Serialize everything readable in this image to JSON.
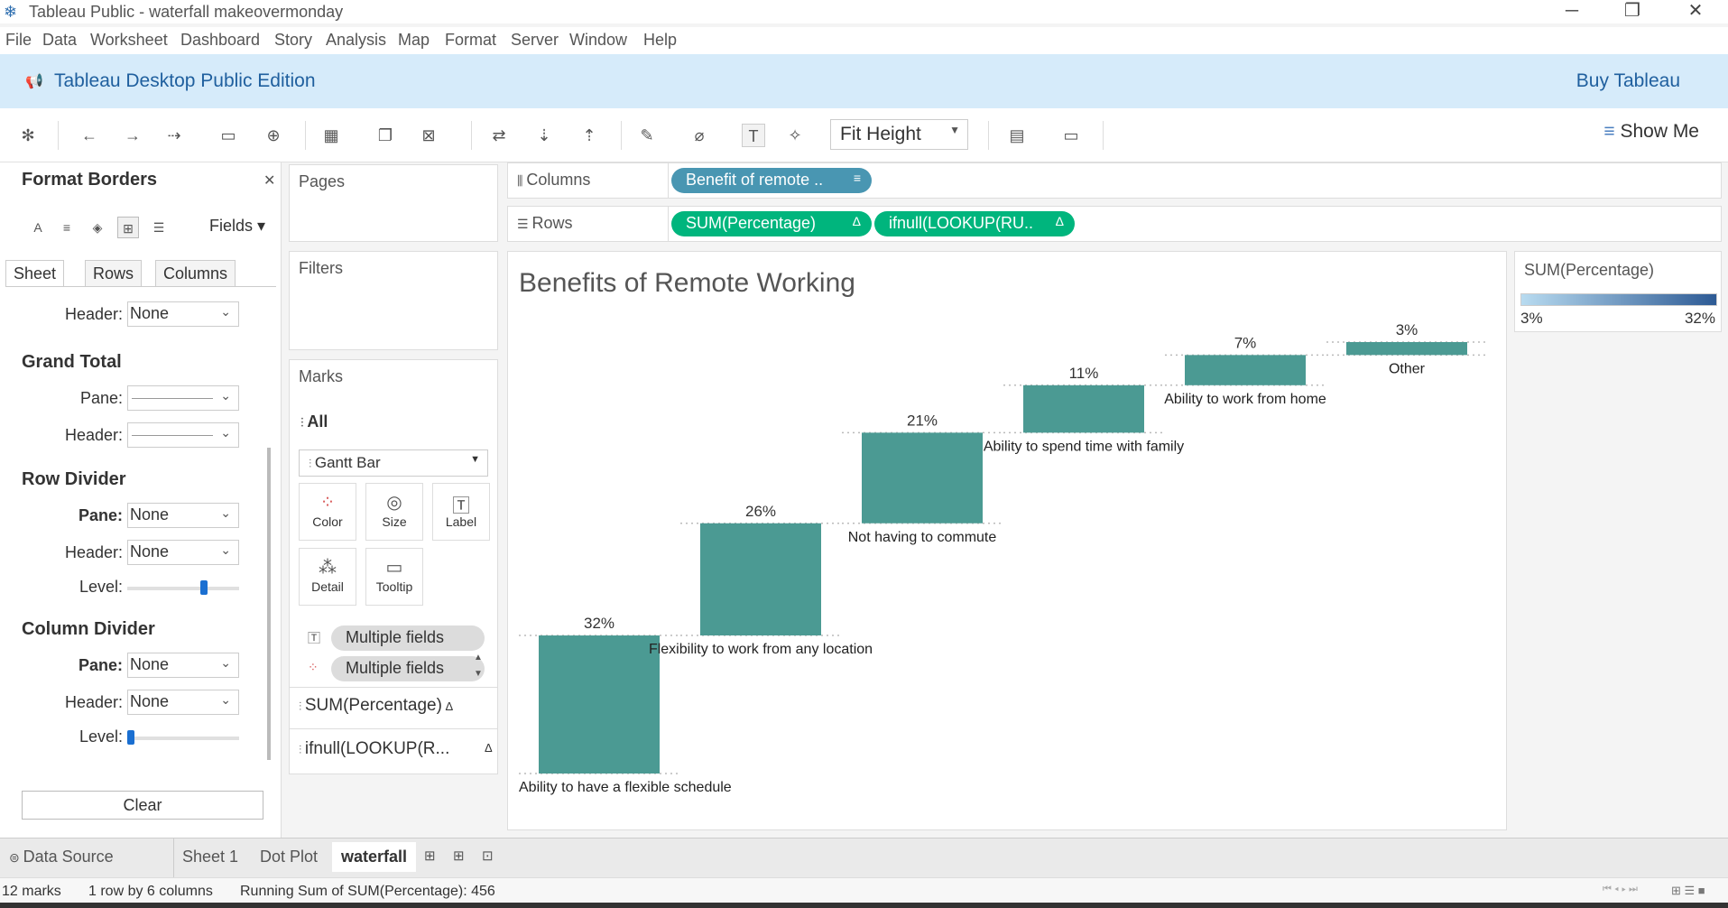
{
  "window": {
    "title": "Tableau Public - waterfall makeovermonday",
    "minimize": "─",
    "restore": "❐",
    "close": "✕"
  },
  "menu": [
    "File",
    "Data",
    "Worksheet",
    "Dashboard",
    "Story",
    "Analysis",
    "Map",
    "Format",
    "Server",
    "Window",
    "Help"
  ],
  "banner": {
    "edition": "Tableau Desktop Public Edition",
    "buy": "Buy Tableau"
  },
  "toolbar": {
    "fit": "Fit Height",
    "show_me": "Show Me"
  },
  "format_panel": {
    "title": "Format Borders",
    "fields_label": "Fields",
    "tabs": [
      "Sheet",
      "Rows",
      "Columns"
    ],
    "header_label": "Header:",
    "pane_label": "Pane:",
    "level_label": "Level:",
    "header_value": "None",
    "grand_total": {
      "title": "Grand Total"
    },
    "row_divider": {
      "title": "Row Divider",
      "pane": "None",
      "header": "None",
      "level": 0.7
    },
    "column_divider": {
      "title": "Column Divider",
      "pane": "None",
      "header": "None",
      "level": 0.0
    },
    "clear_label": "Clear"
  },
  "cards": {
    "pages": "Pages",
    "filters": "Filters",
    "marks": "Marks",
    "all": "All",
    "mark_type": "Gantt Bar",
    "buttons": [
      "Color",
      "Size",
      "Label",
      "Detail",
      "Tooltip"
    ],
    "mark_fields": [
      "Multiple fields",
      "Multiple fields"
    ],
    "measure_1": "SUM(Percentage)",
    "measure_2": "ifnull(LOOKUP(R..."
  },
  "shelves": {
    "columns_label": "Columns",
    "rows_label": "Rows",
    "columns_pill": "Benefit of remote ..",
    "rows_pill_1": "SUM(Percentage)",
    "rows_pill_2": "ifnull(LOOKUP(RU.."
  },
  "legend": {
    "title": "SUM(Percentage)",
    "min": "3%",
    "max": "32%"
  },
  "sheet_tabs": {
    "data_source": "Data Source",
    "tabs": [
      "Sheet 1",
      "Dot Plot",
      "waterfall"
    ],
    "active": "waterfall"
  },
  "status": {
    "marks": "12 marks",
    "dims": "1 row by 6 columns",
    "sum": "Running Sum of SUM(Percentage): 456"
  },
  "colors": {
    "bar": "#4b9a93",
    "banner": "#d6ebfa",
    "pill_green": "#00b57d",
    "pill_teal": "#4996b2"
  },
  "chart_data": {
    "type": "bar",
    "subtype": "waterfall",
    "title": "Benefits of Remote Working",
    "categories": [
      "Ability to have a flexible schedule",
      "Flexibility to work from any location",
      "Not having to commute",
      "Ability to spend time with family",
      "Ability to work from home",
      "Other"
    ],
    "values": [
      32,
      26,
      21,
      11,
      7,
      3
    ],
    "value_labels": [
      "32%",
      "26%",
      "21%",
      "11%",
      "7%",
      "3%"
    ],
    "running_sum_max": 100,
    "grid": false
  }
}
